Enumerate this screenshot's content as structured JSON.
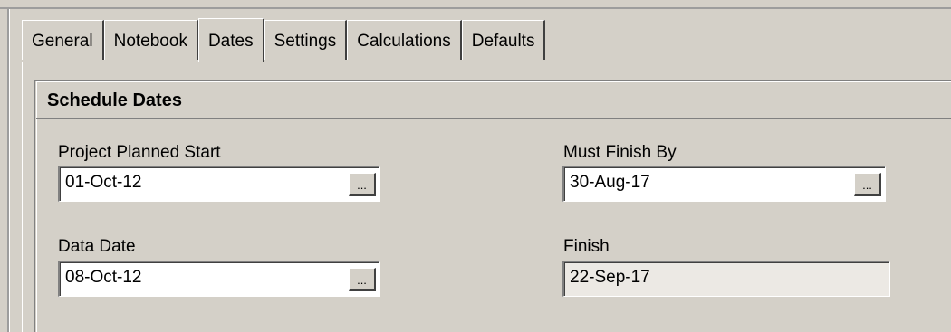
{
  "tabs": [
    {
      "label": "General",
      "active": false
    },
    {
      "label": "Notebook",
      "active": false
    },
    {
      "label": "Dates",
      "active": true
    },
    {
      "label": "Settings",
      "active": false
    },
    {
      "label": "Calculations",
      "active": false
    },
    {
      "label": "Defaults",
      "active": false
    }
  ],
  "group": {
    "title": "Schedule Dates"
  },
  "fields": {
    "project_planned_start": {
      "label": "Project Planned Start",
      "value": "01-Oct-12",
      "button_label": "..."
    },
    "must_finish_by": {
      "label": "Must Finish By",
      "value": "30-Aug-17",
      "button_label": "..."
    },
    "data_date": {
      "label": "Data Date",
      "value": "08-Oct-12",
      "button_label": "..."
    },
    "finish": {
      "label": "Finish",
      "value": "22-Sep-17"
    }
  }
}
